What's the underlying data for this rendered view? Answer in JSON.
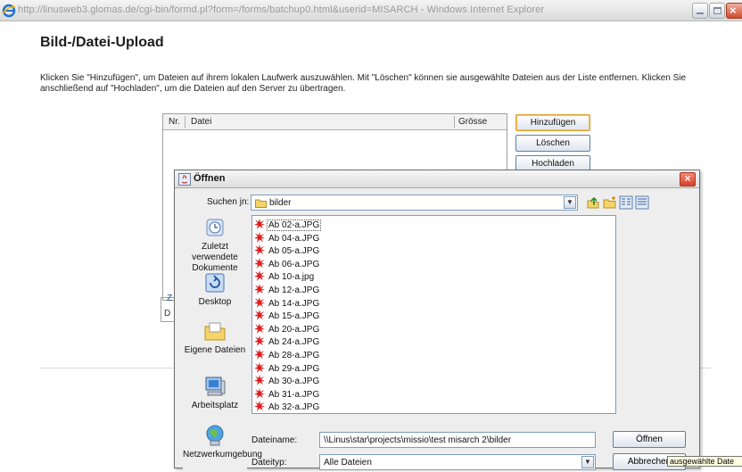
{
  "browser": {
    "title": "http://linusweb3.glomas.de/cgi-bin/formd.pl?form=/forms/batchup0.html&userid=MISARCH - Windows Internet Explorer"
  },
  "page": {
    "title": "Bild-/Datei-Upload",
    "description": "Klicken Sie \"Hinzufügen\", um Dateien auf ihrem lokalen Laufwerk auszuwählen. Mit \"Löschen\" können sie ausgewählte Dateien aus der Liste entfernen. Klicken Sie anschließend auf \"Hochladen\", um die Dateien auf den Server zu übertragen.",
    "table_headers": [
      "Nr.",
      "Datei",
      "Grösse"
    ],
    "buttons": {
      "add": "Hinzufügen",
      "delete": "Löschen",
      "upload": "Hochladen"
    },
    "stub_z": "Z",
    "stub_d": "D"
  },
  "dialog": {
    "title": "Öffnen",
    "look_in_label": "Suchen in:",
    "look_in_mnemonic": "j",
    "look_in_value": "bilder",
    "places": [
      "Zuletzt verwendete Dokumente",
      "Desktop",
      "Eigene Dateien",
      "Arbeitsplatz",
      "Netzwerkumgebung"
    ],
    "files": [
      "Ab 02-a.JPG",
      "Ab 04-a.JPG",
      "Ab 05-a.JPG",
      "Ab 06-a.JPG",
      "Ab 10-a.jpg",
      "Ab 12-a.JPG",
      "Ab 14-a.JPG",
      "Ab 15-a.JPG",
      "Ab 20-a.JPG",
      "Ab 24-a.JPG",
      "Ab 28-a.JPG",
      "Ab 29-a.JPG",
      "Ab 30-a.JPG",
      "Ab 31-a.JPG",
      "Ab 32-a.JPG"
    ],
    "filename_label": "Dateiname:",
    "filename_value": "\\\\Linus\\star\\projects\\missio\\test misarch 2\\bilder",
    "filetype_label": "Dateityp:",
    "filetype_value": "Alle Dateien",
    "open_button": "Öffnen",
    "cancel_button": "Abbrechen",
    "tooltip": "ausgewählte Date"
  },
  "colors": {
    "accent": "#7f9db9",
    "file_icon": "#e02020",
    "folder": "#f5d468"
  }
}
